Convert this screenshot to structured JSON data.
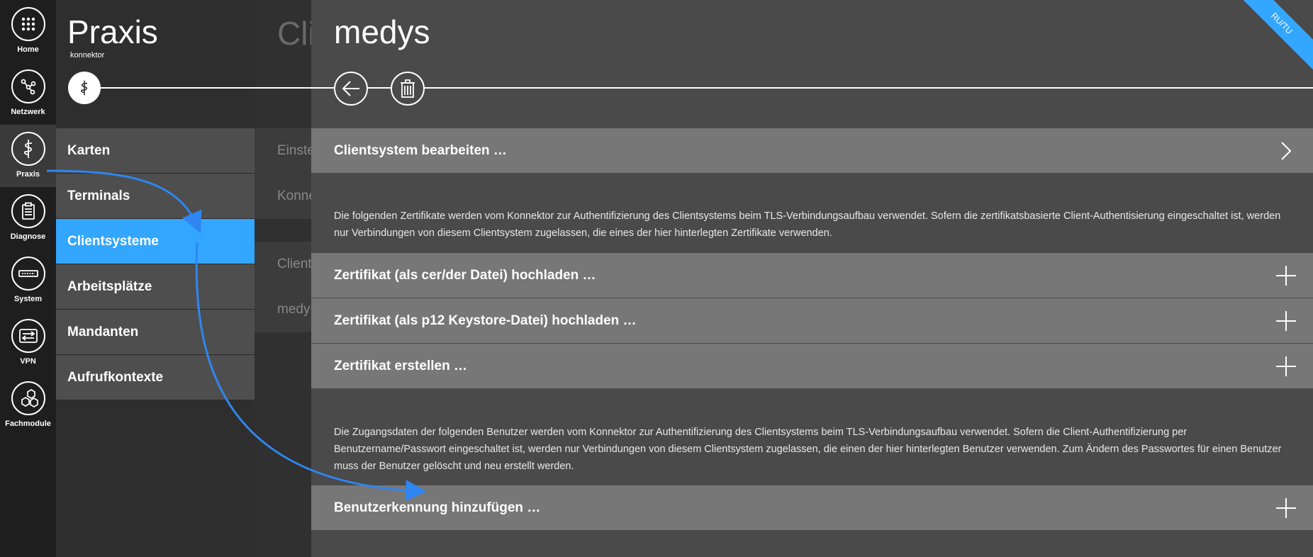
{
  "rail": [
    {
      "label": "Home",
      "icon": "grid-icon"
    },
    {
      "label": "Netzwerk",
      "icon": "network-icon"
    },
    {
      "label": "Praxis",
      "icon": "caduceus-icon"
    },
    {
      "label": "Diagnose",
      "icon": "clipboard-icon"
    },
    {
      "label": "System",
      "icon": "server-icon"
    },
    {
      "label": "VPN",
      "icon": "vpn-icon"
    },
    {
      "label": "Fachmodule",
      "icon": "hexagons-icon"
    }
  ],
  "praxis": {
    "title": "Praxis",
    "subtitle": "konnektor",
    "menu": [
      "Karten",
      "Terminals",
      "Clientsysteme",
      "Arbeitsplätze",
      "Mandanten",
      "Aufrufkontexte"
    ],
    "active_index": 2
  },
  "middle": {
    "title": "Cli",
    "item1": "Einste",
    "item2": "Konne",
    "item3": "Client",
    "item4": "medy"
  },
  "main": {
    "title": "medys",
    "corner_label": "RU/TU",
    "edit_row": "Clientsystem bearbeiten …",
    "cert_info": "Die folgenden Zertifikate werden vom Konnektor zur Authentifizierung des Clientsystems beim TLS-Verbindungsaufbau verwendet. Sofern die zertifikatsbasierte Client-Authentisierung eingeschaltet ist, werden nur Verbindungen von diesem Clientsystem zugelassen, die eines der hier hinterlegten Zertifikate verwenden.",
    "cert_rows": [
      "Zertifikat (als cer/der Datei) hochladen …",
      "Zertifikat (als p12 Keystore-Datei) hochladen …",
      "Zertifikat erstellen …"
    ],
    "user_info": "Die Zugangsdaten der folgenden Benutzer werden vom Konnektor zur Authentifizierung des Clientsystems beim TLS-Verbindungsaufbau verwendet. Sofern die Client-Authentifizierung per Benutzername/Passwort eingeschaltet ist, werden nur Verbindungen von diesem Clientsystem zugelassen, die einen der hier hinterlegten Benutzer verwenden. Zum Ändern des Passwortes für einen Benutzer muss der Benutzer gelöscht und neu erstellt werden.",
    "user_row": "Benutzerkennung hinzufügen …"
  },
  "colors": {
    "accent": "#33a6ff",
    "row": "#777777",
    "panel": "#4a4a4a"
  }
}
